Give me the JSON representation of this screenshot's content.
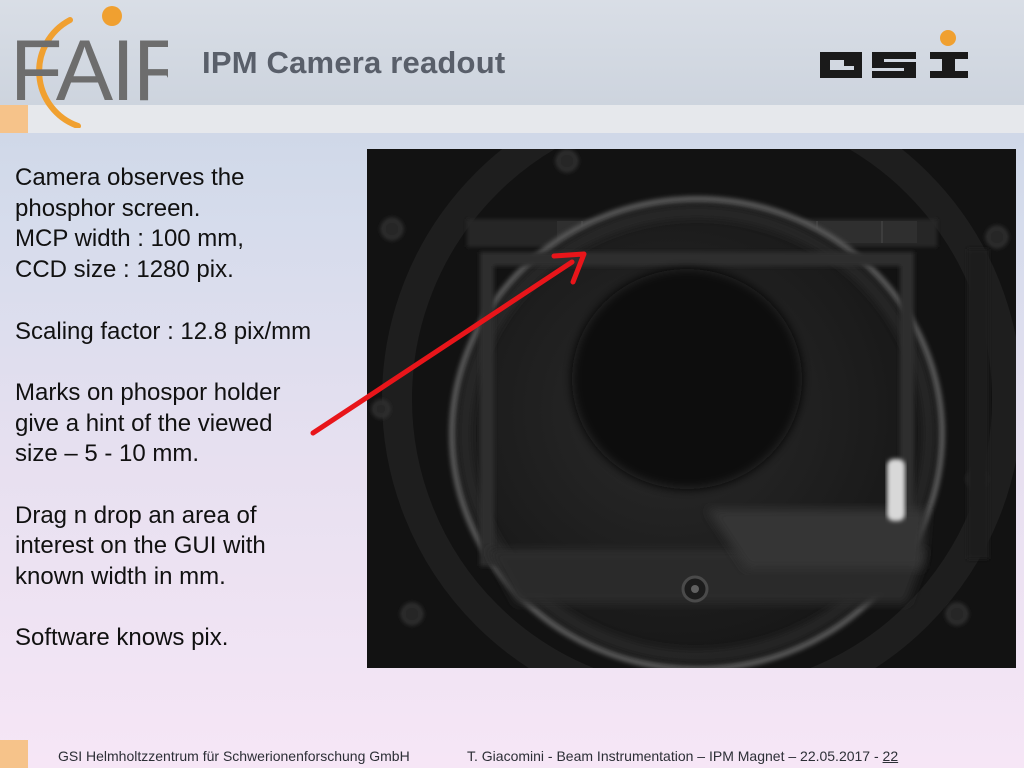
{
  "header": {
    "title": "IPM Camera readout",
    "fair_logo_text": "FAIR",
    "gsi_logo_text": "GSI"
  },
  "content": {
    "paragraphs": [
      "Camera observes the\nphosphor screen.\nMCP width : 100 mm,\nCCD size : 1280 pix.",
      "Scaling factor : 12.8 pix/mm",
      "Marks on phospor holder\ngive a hint of the viewed\nsize – 5 - 10 mm.",
      "Drag n drop an area of\ninterest on the GUI with\nknown width in mm.",
      "Software knows pix."
    ]
  },
  "footer": {
    "institution": "GSI Helmholtzzentrum für Schwerionenforschung GmbH",
    "presentation_info": "T. Giacomini - Beam Instrumentation – IPM Magnet – 22.05.2017 - ",
    "page_number": "22"
  },
  "colors": {
    "accent_orange": "#f6c38a",
    "fair_gray": "#6d6d6d",
    "fair_orange": "#f0a030",
    "gsi_dark": "#1a1a1a",
    "arrow_red": "#e8151a",
    "title_gray": "#595f6a"
  }
}
